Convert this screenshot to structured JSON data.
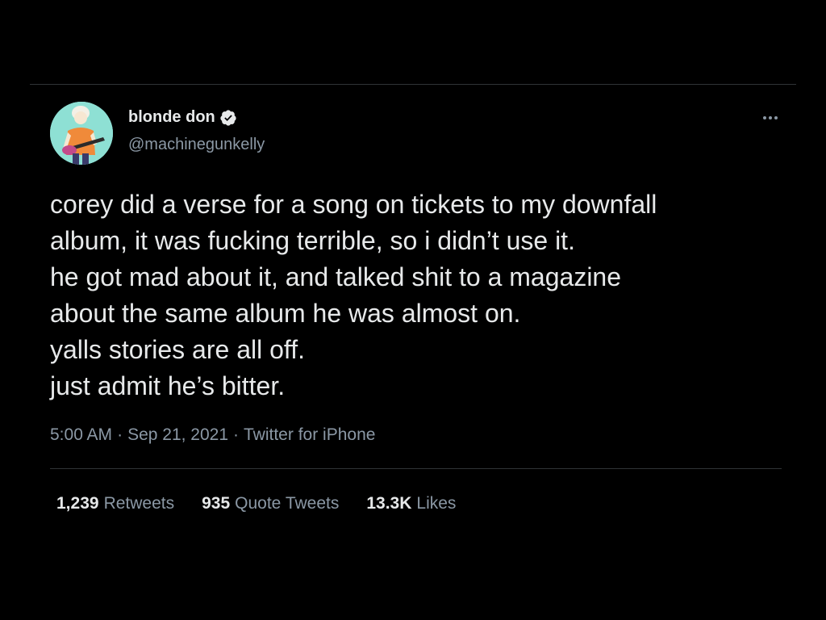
{
  "author": {
    "display_name": "blonde don",
    "handle": "@machinegunkelly",
    "verified": true,
    "avatar": "avatar-illustration"
  },
  "tweet": {
    "lines": [
      "corey did a verse for a song on tickets to my downfall",
      "album, it was fucking terrible, so i didn’t use it.",
      "he got mad about it, and talked shit to a magazine",
      "about the same album he was almost on.",
      "yalls stories are all off.",
      "just admit he’s bitter."
    ]
  },
  "meta": {
    "time": "5:00 AM",
    "separator1": "·",
    "date": "Sep 21, 2021",
    "separator2": "·",
    "source": "Twitter for iPhone"
  },
  "stats": {
    "retweets": {
      "count": "1,239",
      "label": "Retweets"
    },
    "quotes": {
      "count": "935",
      "label": "Quote Tweets"
    },
    "likes": {
      "count": "13.3K",
      "label": "Likes"
    }
  },
  "icons": {
    "verified": "verified-badge-icon",
    "more": "more-options-icon"
  },
  "colors": {
    "background": "#000000",
    "primary_text": "#e7e9ea",
    "secondary_text": "#8b98a5",
    "divider": "#2f3336"
  }
}
